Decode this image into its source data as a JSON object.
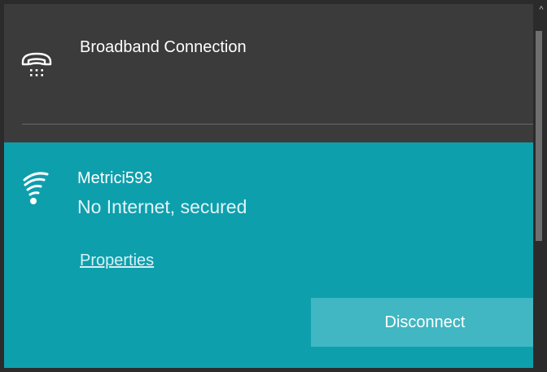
{
  "networks": {
    "dialup": {
      "name": "Broadband Connection",
      "icon": "dialup-phone-icon"
    },
    "wifi": {
      "name": "Metrici593",
      "status": "No Internet, secured",
      "properties_label": "Properties",
      "disconnect_label": "Disconnect",
      "icon": "wifi-signal-icon"
    }
  },
  "scrollbar": {
    "up_arrow": "^",
    "icon": "chevron-up-icon"
  },
  "colors": {
    "panel_bg": "#3b3b3b",
    "selected_bg": "#0e9fad",
    "button_bg": "#40b7c2"
  }
}
